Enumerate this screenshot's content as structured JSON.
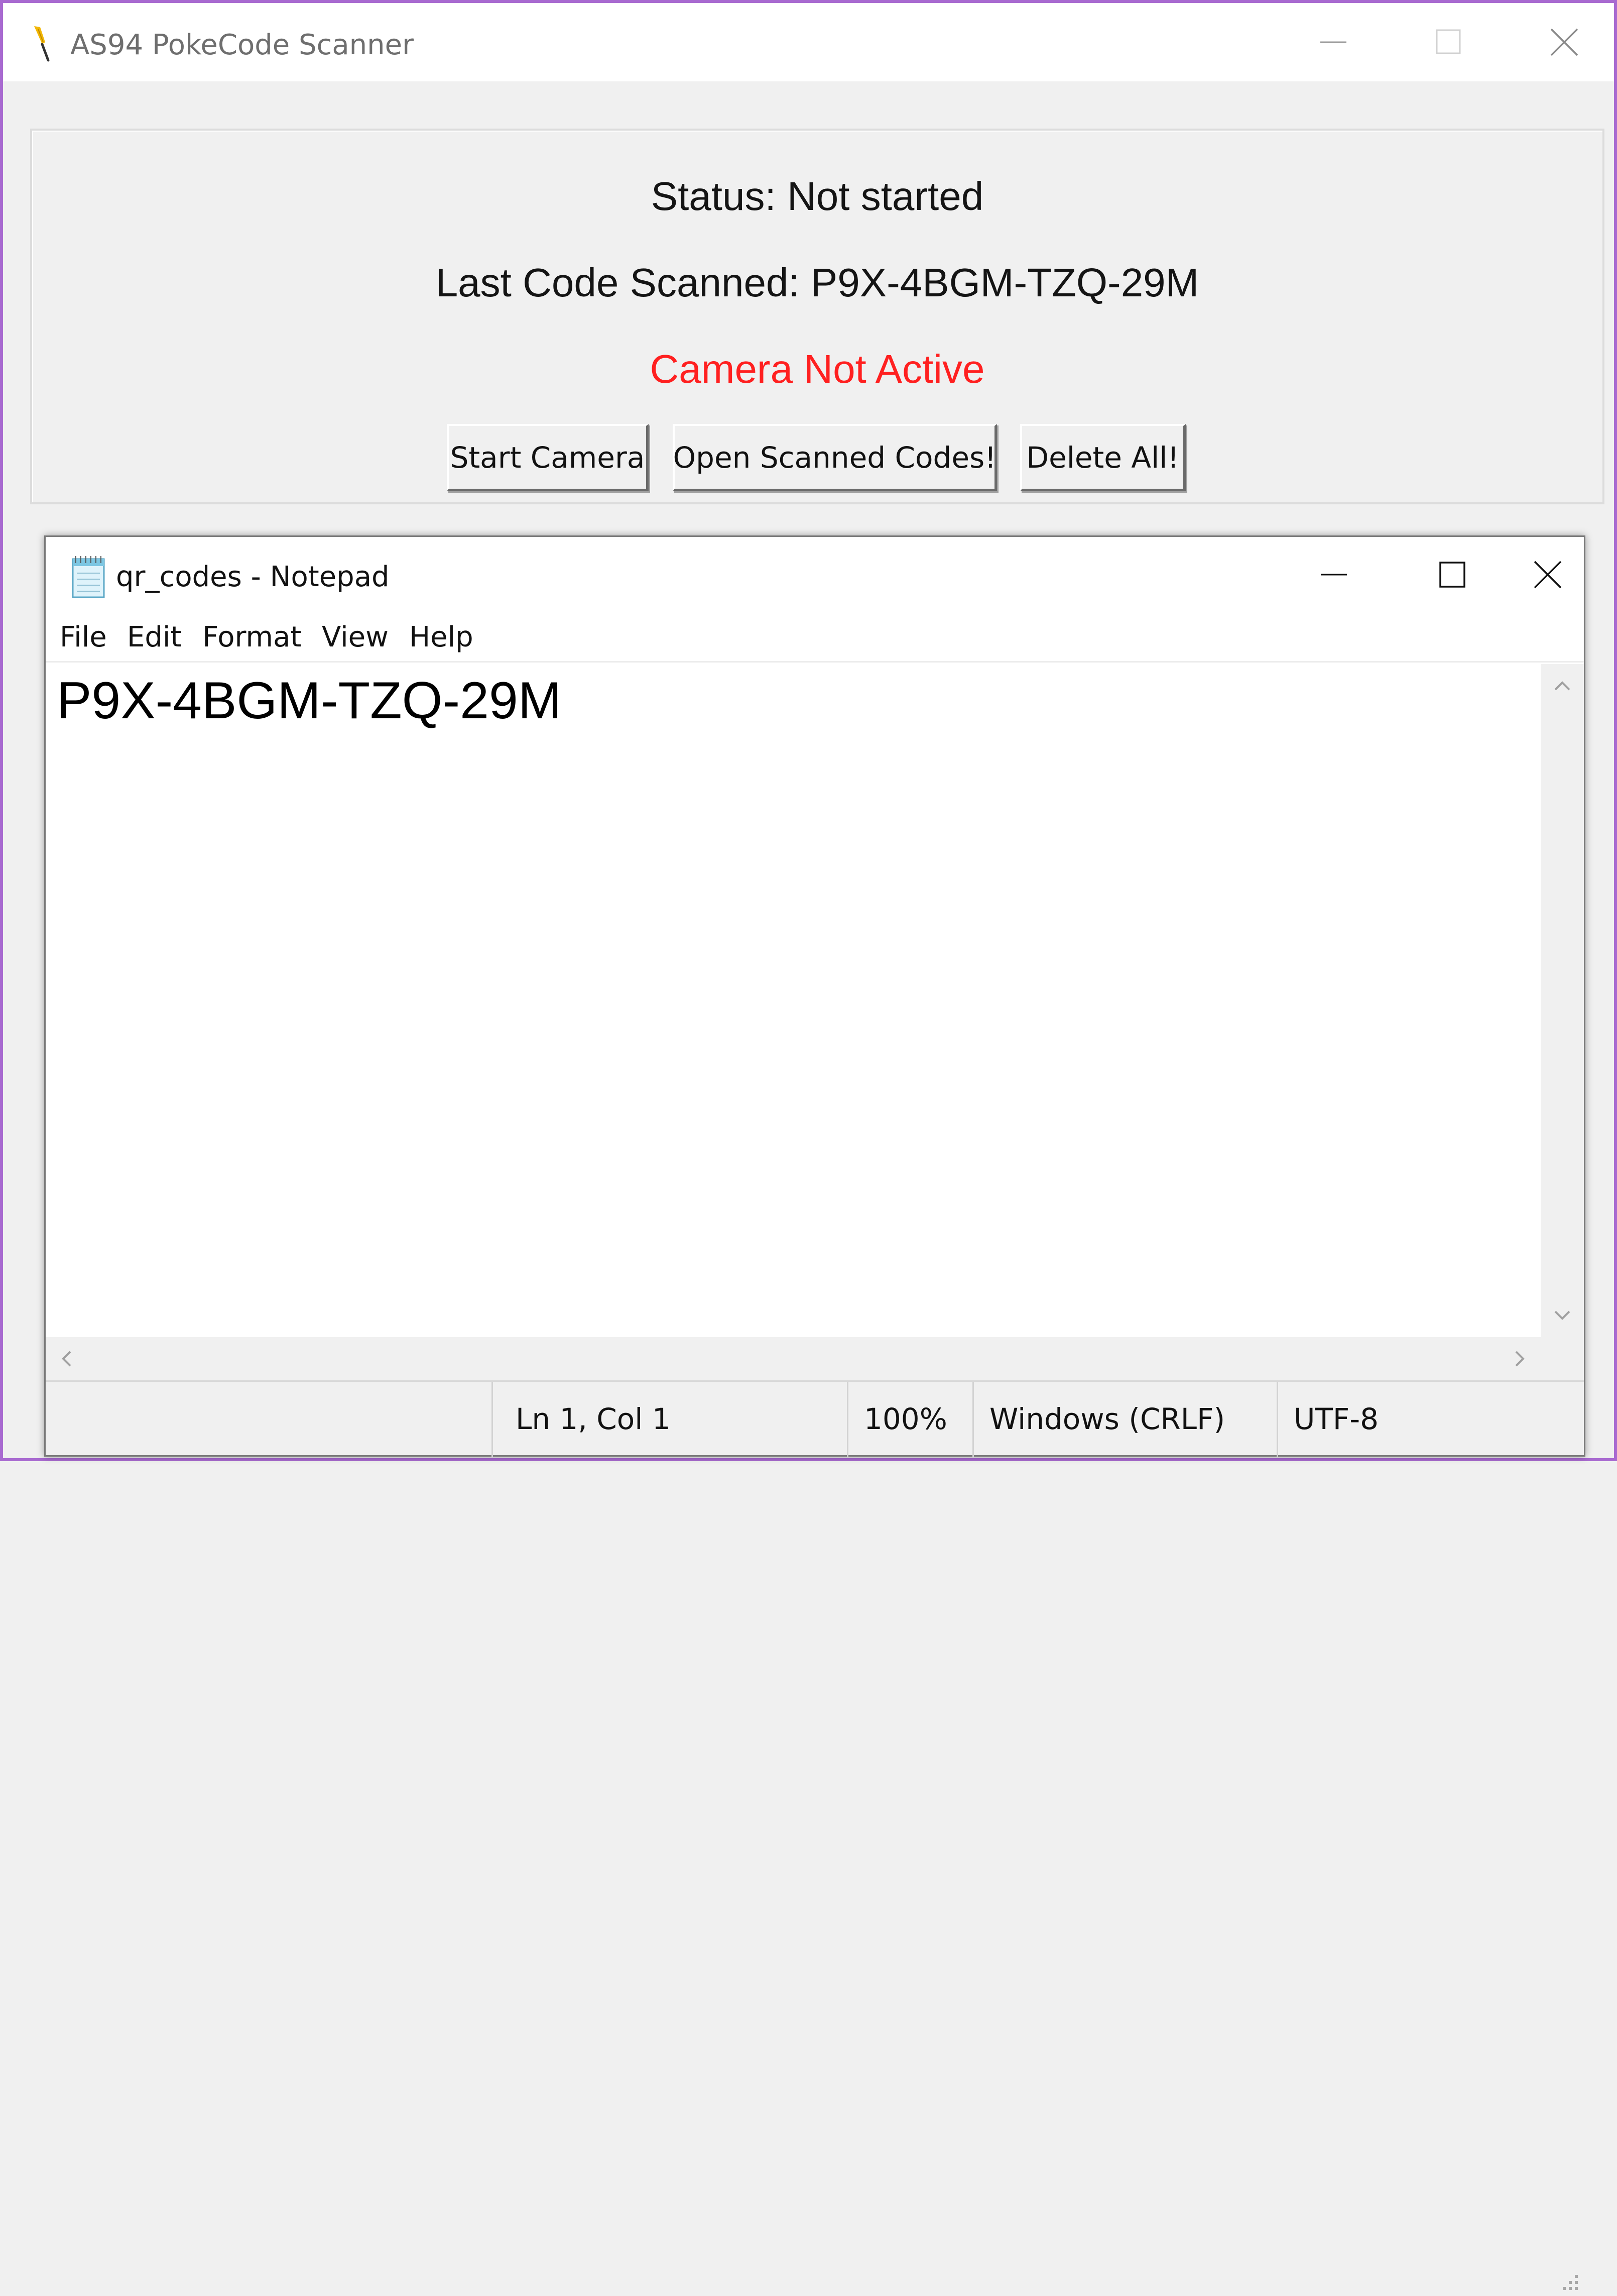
{
  "scanner": {
    "title": "AS94 PokeCode Scanner",
    "status": "Status: Not started",
    "last_code": "Last Code Scanned: P9X-4BGM-TZQ-29M",
    "camera_state": "Camera Not Active",
    "buttons": {
      "start_camera": "Start Camera",
      "open_scanned": "Open Scanned Codes!",
      "delete_all": "Delete All!"
    }
  },
  "notepad": {
    "title": "qr_codes - Notepad",
    "menu": [
      "File",
      "Edit",
      "Format",
      "View",
      "Help"
    ],
    "content": "P9X-4BGM-TZQ-29M",
    "status": {
      "position": "Ln 1, Col 1",
      "zoom": "100%",
      "line_endings": "Windows (CRLF)",
      "encoding": "UTF-8"
    }
  },
  "colors": {
    "window_border": "#a86ad0",
    "camera_inactive": "#ff2020",
    "body_bg": "#f0f0f0"
  },
  "icons": {
    "scanner_app": "feather-pen-icon",
    "notepad_app": "notepad-icon",
    "minimize": "minimize-icon",
    "maximize": "maximize-icon",
    "close": "close-icon"
  }
}
